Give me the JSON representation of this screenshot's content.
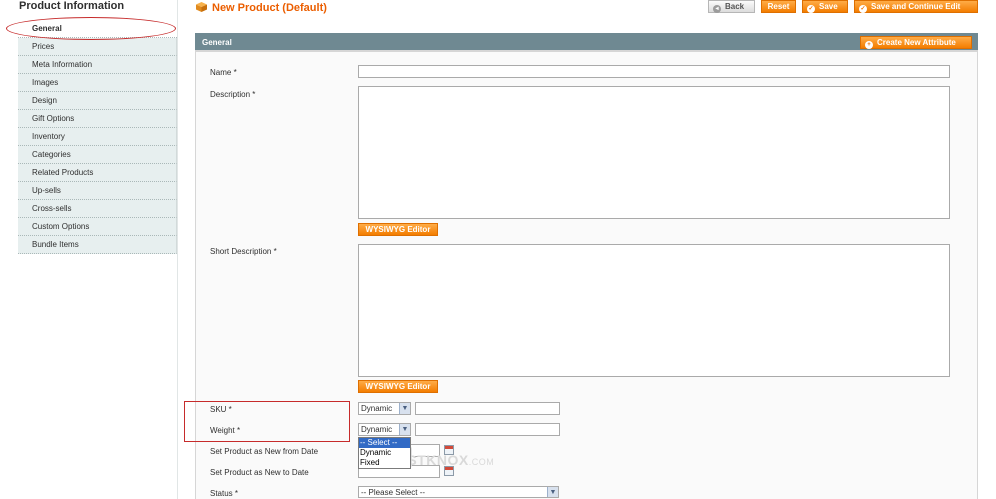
{
  "sidebar": {
    "title": "Product Information",
    "items": [
      {
        "label": "General"
      },
      {
        "label": "Prices"
      },
      {
        "label": "Meta Information"
      },
      {
        "label": "Images"
      },
      {
        "label": "Design"
      },
      {
        "label": "Gift Options"
      },
      {
        "label": "Inventory"
      },
      {
        "label": "Categories"
      },
      {
        "label": "Related Products"
      },
      {
        "label": "Up-sells"
      },
      {
        "label": "Cross-sells"
      },
      {
        "label": "Custom Options"
      },
      {
        "label": "Bundle Items"
      }
    ],
    "active_item": "General"
  },
  "header": {
    "title": "New Product (Default)",
    "buttons": {
      "back": "Back",
      "reset": "Reset",
      "save": "Save",
      "save_continue": "Save and Continue Edit"
    }
  },
  "fieldset": {
    "title": "General",
    "create_attribute": "Create New Attribute"
  },
  "form": {
    "name_label": "Name *",
    "name_value": "",
    "description_label": "Description *",
    "description_value": "",
    "wysiwyg_label": "WYSIWYG Editor",
    "short_description_label": "Short Description *",
    "short_description_value": "",
    "sku_label": "SKU *",
    "sku_type_selected": "Dynamic",
    "sku_value": "",
    "weight_label": "Weight *",
    "weight_type_selected": "Dynamic",
    "weight_value": "",
    "weight_type_options": [
      "-- Select --",
      "Dynamic",
      "Fixed"
    ],
    "weight_type_highlighted": "-- Select --",
    "new_from_label": "Set Product as New from Date",
    "new_to_label": "Set Product as New to Date",
    "status_label": "Status *",
    "status_selected": "-- Please Select --"
  },
  "watermark": {
    "text": "OSTKNOX",
    "suffix": ".COM"
  },
  "colors": {
    "accent": "#eb5e00",
    "button_orange": "#f37d00",
    "fieldset_header": "#6f8992",
    "sidebar_bg": "#e7efef",
    "annotation_red": "#c62b2b"
  }
}
